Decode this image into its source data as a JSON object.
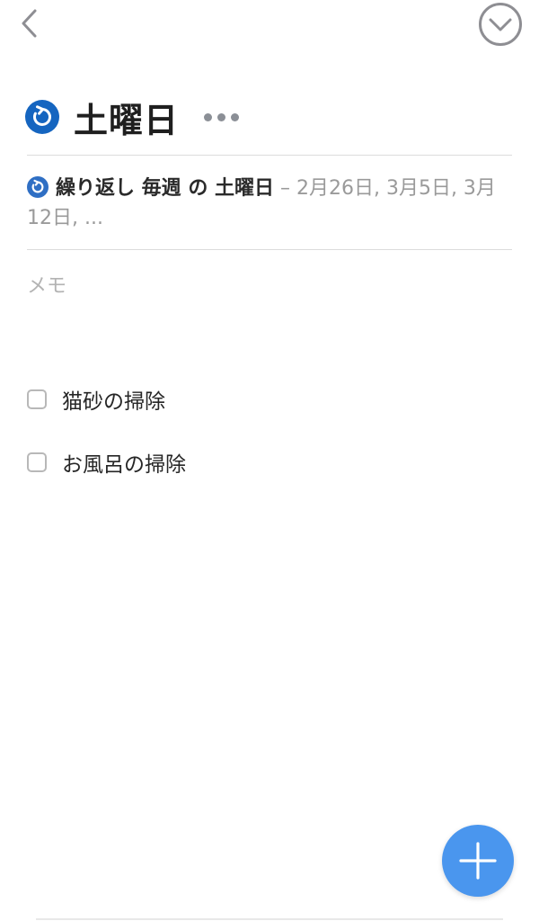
{
  "header": {
    "back_icon": "chevron-left-icon",
    "collapse_icon": "chevron-down-circle-icon"
  },
  "task": {
    "title": "土曜日",
    "title_icon": "repeat-circle-icon",
    "more_icon": "more-horizontal-icon"
  },
  "repeat": {
    "icon": "repeat-circle-icon",
    "label": "繰り返し 毎週 の 土曜日",
    "dates": " – 2月26日, 3月5日, 3月12日, ..."
  },
  "memo": {
    "placeholder": "メモ"
  },
  "checklist": [
    {
      "label": "猫砂の掃除",
      "checked": false
    },
    {
      "label": "お風呂の掃除",
      "checked": false
    }
  ],
  "fab": {
    "icon": "plus-icon"
  },
  "colors": {
    "accent": "#1565c0",
    "fab": "#4a96ee",
    "muted_text": "#9a9a9a",
    "placeholder": "#b3b3b3",
    "divider": "#dcdcdc"
  }
}
